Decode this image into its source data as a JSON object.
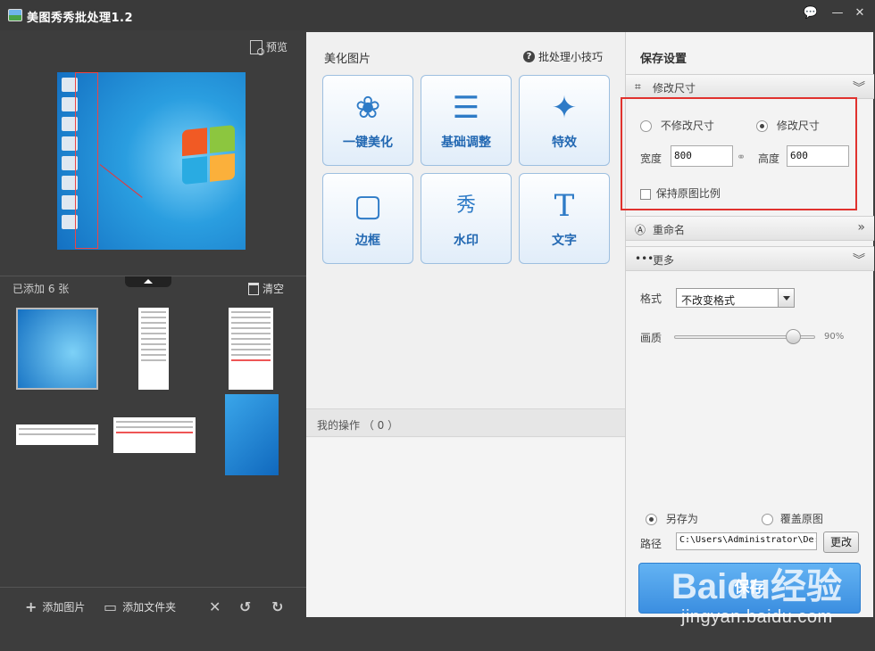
{
  "window": {
    "title": "美图秀秀批处理1.2",
    "controls": [
      "💬",
      "—",
      "□",
      "✕"
    ]
  },
  "left": {
    "preview_label": "预览",
    "added_count": "已添加 6 张",
    "clear_label": "清空",
    "toolbar": {
      "add_image": "添加图片",
      "add_folder": "添加文件夹"
    }
  },
  "center": {
    "title": "美化图片",
    "tips": "批处理小技巧",
    "tools": [
      {
        "label": "一键美化",
        "icon": "tulip-icon"
      },
      {
        "label": "基础调整",
        "icon": "sliders-icon"
      },
      {
        "label": "特效",
        "icon": "magic-wand-icon"
      },
      {
        "label": "边框",
        "icon": "frame-icon"
      },
      {
        "label": "水印",
        "icon": "watermark-icon"
      },
      {
        "label": "文字",
        "icon": "text-icon"
      }
    ],
    "tool_glyphs": [
      "❀",
      "☰",
      "✦",
      "▢",
      "秀",
      "T"
    ],
    "my_ops": "我的操作 （ 0 ）"
  },
  "right": {
    "title": "保存设置",
    "resize": {
      "header": "修改尺寸",
      "no_resize": "不修改尺寸",
      "do_resize": "修改尺寸",
      "selected": "do_resize",
      "width_label": "宽度",
      "width_value": "800",
      "height_label": "高度",
      "height_value": "600",
      "keep_ratio_label": "保持原图比例",
      "keep_ratio": false
    },
    "rename": {
      "header": "重命名"
    },
    "more": {
      "header": "更多",
      "format_label": "格式",
      "format_value": "不改变格式",
      "quality_label": "画质",
      "quality_value": "90%",
      "quality": 0.9
    },
    "save_as": "另存为",
    "overwrite": "覆盖原图",
    "save_mode": "save_as",
    "path_label": "路径",
    "path_value": "C:\\Users\\Administrator\\De:",
    "change_button": "更改",
    "save_button": "保存"
  },
  "watermark": {
    "brand": "Baidu经验",
    "url": "jingyan.baidu.com"
  },
  "colors": {
    "accent_blue": "#2e7bc7",
    "save_blue": "#3b8ee0",
    "highlight_red": "#e0322e",
    "dark_bg": "#3d3d3d"
  }
}
